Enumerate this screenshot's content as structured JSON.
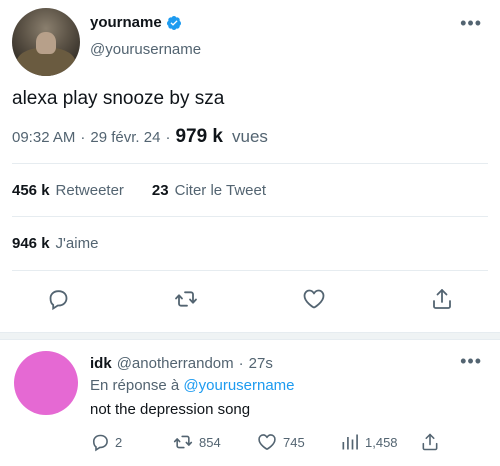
{
  "tweet": {
    "display_name": "yourname",
    "handle": "@yourusername",
    "text": "alexa play snooze by sza",
    "time": "09:32 AM",
    "date": "29 févr. 24",
    "views_count": "979 k",
    "views_label": "vues",
    "retweets_count": "456 k",
    "retweets_label": "Retweeter",
    "quotes_count": "23",
    "quotes_label": "Citer le Tweet",
    "likes_count": "946 k",
    "likes_label": "J'aime",
    "more_glyph": "•••"
  },
  "reply": {
    "display_name": "idk",
    "handle": "@anotherrandom",
    "time": "27s",
    "reply_to_prefix": "En réponse à",
    "reply_to_handle": "@yourusername",
    "text": "not the depression song",
    "reply_count": "2",
    "retweet_count": "854",
    "like_count": "745",
    "views_count": "1,458",
    "more_glyph": "•••",
    "avatar_color": "#e569d3"
  },
  "colors": {
    "text_primary": "#0f1419",
    "text_secondary": "#536471",
    "accent": "#1d9bf0"
  },
  "icons": {
    "verified": "verified-badge-icon",
    "reply": "reply-bubble-icon",
    "retweet": "retweet-icon",
    "like": "heart-icon",
    "share": "share-icon",
    "views": "analytics-bars-icon"
  }
}
